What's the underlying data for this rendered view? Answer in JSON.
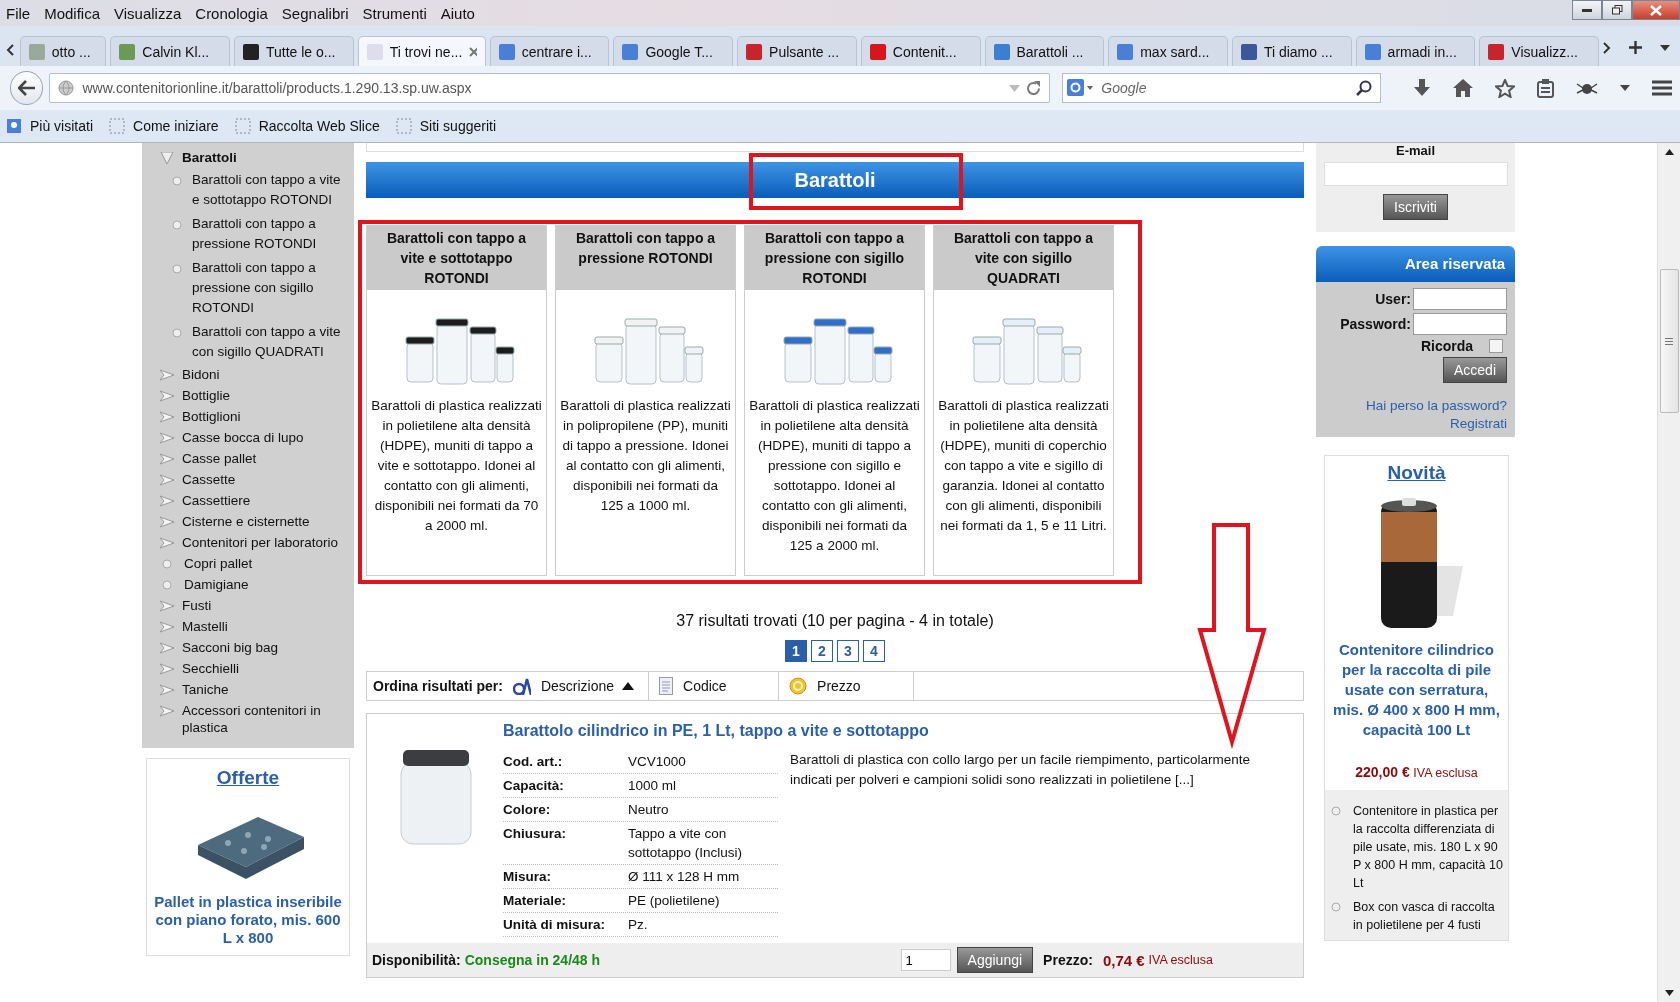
{
  "menu_bar": [
    "File",
    "Modifica",
    "Visualizza",
    "Cronologia",
    "Segnalibri",
    "Strumenti",
    "Aiuto"
  ],
  "tabs": [
    {
      "label": "otto ...",
      "selected": false
    },
    {
      "label": "Calvin Kl...",
      "selected": false
    },
    {
      "label": "Tutte le o...",
      "selected": false
    },
    {
      "label": "Ti trovi ne...",
      "selected": true
    },
    {
      "label": "centrare i...",
      "selected": false
    },
    {
      "label": "Google T...",
      "selected": false
    },
    {
      "label": "Pulsante ...",
      "selected": false
    },
    {
      "label": "Contenit...",
      "selected": false
    },
    {
      "label": "Barattoli ...",
      "selected": false
    },
    {
      "label": "max sard...",
      "selected": false
    },
    {
      "label": "Ti diamo ...",
      "selected": false
    },
    {
      "label": "armadi in...",
      "selected": false
    },
    {
      "label": "Visualizz...",
      "selected": false
    }
  ],
  "address_bar": {
    "url": "www.contenitorionline.it/barattoli/products.1.290.13.sp.uw.aspx"
  },
  "search": {
    "placeholder": "Google"
  },
  "bookmarks": [
    "Più visitati",
    "Come iniziare",
    "Raccolta Web Slice",
    "Siti suggeriti"
  ],
  "sidebar": {
    "items": [
      {
        "label": "Barattoli",
        "kind": "branch",
        "expanded": true,
        "children": [
          {
            "label": "Barattoli con tappo a vite e sottotappo ROTONDI"
          },
          {
            "label": "Barattoli con tappo a pressione ROTONDI"
          },
          {
            "label": "Barattoli con tappo a pressione con sigillo ROTONDI"
          },
          {
            "label": "Barattoli con tappo a vite con sigillo QUADRATI"
          }
        ]
      },
      {
        "label": "Bidoni",
        "kind": "branch",
        "expanded": false
      },
      {
        "label": "Bottiglie",
        "kind": "branch",
        "expanded": false
      },
      {
        "label": "Bottiglioni",
        "kind": "branch",
        "expanded": false
      },
      {
        "label": "Casse bocca di lupo",
        "kind": "branch",
        "expanded": false
      },
      {
        "label": "Casse pallet",
        "kind": "branch",
        "expanded": false
      },
      {
        "label": "Cassette",
        "kind": "branch",
        "expanded": false
      },
      {
        "label": "Cassettiere",
        "kind": "branch",
        "expanded": false
      },
      {
        "label": "Cisterne e cisternette",
        "kind": "branch",
        "expanded": false
      },
      {
        "label": "Contenitori per laboratorio",
        "kind": "branch",
        "expanded": false
      },
      {
        "label": "Copri pallet",
        "kind": "leaf"
      },
      {
        "label": "Damigiane",
        "kind": "leaf"
      },
      {
        "label": "Fusti",
        "kind": "branch",
        "expanded": false
      },
      {
        "label": "Mastelli",
        "kind": "branch",
        "expanded": false
      },
      {
        "label": "Sacconi big bag",
        "kind": "branch",
        "expanded": false
      },
      {
        "label": "Secchielli",
        "kind": "branch",
        "expanded": false
      },
      {
        "label": "Taniche",
        "kind": "branch",
        "expanded": false
      },
      {
        "label": "Accessori contenitori in plastica",
        "kind": "branch",
        "expanded": false
      }
    ]
  },
  "offers": {
    "title": "Offerte",
    "product": "Pallet in plastica inseribile con piano forato, mis. 600 L x 800"
  },
  "banner": {
    "title": "Barattoli"
  },
  "categories": [
    {
      "title": "Barattoli con tappo a vite e sottotappo ROTONDI",
      "description": "Barattoli di plastica realizzati in polietilene alta densità (HDPE), muniti di tappo a vite e sottotappo. Idonei al contatto con gli alimenti, disponibili nei formati da 70 a 2000 ml."
    },
    {
      "title": "Barattoli con tappo a pressione ROTONDI",
      "description": "Barattoli di plastica realizzati in polipropilene (PP), muniti di tappo a pressione. Idonei al contatto con gli alimenti, disponibili nei formati da 125 a 1000 ml."
    },
    {
      "title": "Barattoli con tappo a pressione con sigillo ROTONDI",
      "description": "Barattoli di plastica realizzati in polietilene alta densità (HDPE), muniti di tappo a pressione con sigillo e sottotappo. Idonei al contatto con gli alimenti, disponibili nei formati da 125 a 2000 ml."
    },
    {
      "title": "Barattoli con tappo a vite con sigillo QUADRATI",
      "description": "Barattoli di plastica realizzati in polietilene alta densità (HDPE), muniti di coperchio con tappo a vite e sigillo di garanzia. Idonei al contatto con gli alimenti, disponibili nei formati da 1, 5 e 11 Litri."
    }
  ],
  "results": {
    "summary": "37 risultati trovati (10 per pagina - 4 in totale)",
    "pages": [
      {
        "label": "1",
        "selected": true
      },
      {
        "label": "2",
        "selected": false
      },
      {
        "label": "3",
        "selected": false
      },
      {
        "label": "4",
        "selected": false
      }
    ]
  },
  "sort": {
    "label": "Ordina risultati per:",
    "options": [
      {
        "label": "Descrizione",
        "selected": true
      },
      {
        "label": "Codice",
        "selected": false
      },
      {
        "label": "Prezzo",
        "selected": false
      }
    ]
  },
  "product": {
    "title": "Barattolo cilindrico in PE, 1 Lt, tappo a vite e sottotappo",
    "specs": [
      {
        "label": "Cod. art.:",
        "value": "VCV1000"
      },
      {
        "label": "Capacità:",
        "value": "1000 ml"
      },
      {
        "label": "Colore:",
        "value": "Neutro"
      },
      {
        "label": "Chiusura:",
        "value": "Tappo a vite con sottotappo (Inclusi)"
      },
      {
        "label": "Misura:",
        "value": "Ø 111 x 128 H mm"
      },
      {
        "label": "Materiale:",
        "value": "PE (polietilene)"
      },
      {
        "label": "Unità di misura:",
        "value": "Pz."
      }
    ],
    "description": "Barattoli di plastica con collo largo per un facile riempimento, particolarmente indicati per polveri e campioni solidi sono realizzati in polietilene [...]",
    "availability_label": "Disponibilità:",
    "availability": "Consegna in 24/48 h",
    "quantity": "1",
    "add_button": "Aggiungi",
    "price_label": "Prezzo:",
    "price": "0,74 €",
    "tax_note": "IVA esclusa"
  },
  "newsletter": {
    "label": "E-mail",
    "button": "Iscriviti"
  },
  "login": {
    "title": "Area riservata",
    "user_label": "User:",
    "password_label": "Password:",
    "remember_label": "Ricorda",
    "remember_checked": false,
    "button": "Accedi",
    "forgot_link": "Hai perso la password?",
    "register_link": "Registrati"
  },
  "news": {
    "title": "Novità",
    "product": "Contenitore cilindrico per la raccolta di pile usate con serratura, mis. Ø 400 x 800 H mm, capacità 100 Lt",
    "price": "220,00 €",
    "tax_note": "IVA esclusa",
    "items": [
      "Contenitore in plastica per la raccolta differenziata di pile usate, mis. 180 L x 90 P x 800 H mm, capacità 10 Lt",
      "Box con vasca di raccolta in polietilene per 4 fusti"
    ]
  }
}
